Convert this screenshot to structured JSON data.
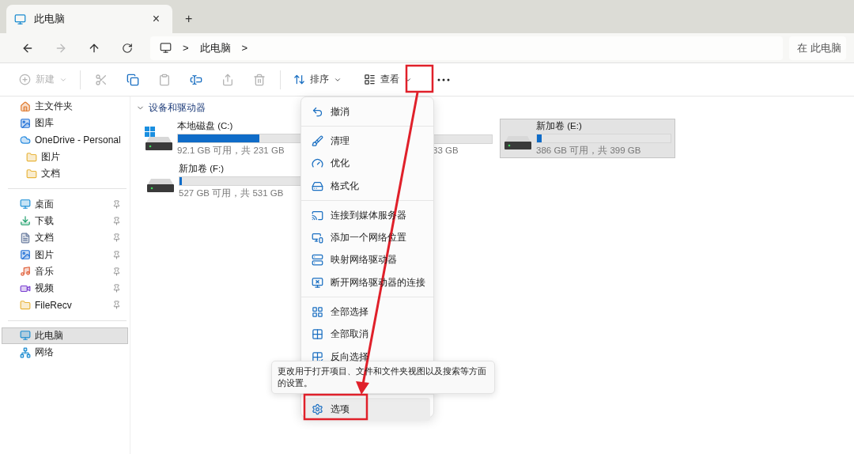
{
  "tabs": [
    {
      "title": "此电脑",
      "selected": true,
      "close": "×"
    }
  ],
  "new_tab": "+",
  "address": {
    "crumbs": [
      "此电脑"
    ],
    "separator": ">"
  },
  "search": {
    "placeholder": "在 此电脑"
  },
  "toolbar": {
    "new": {
      "label": "新建",
      "disabled": true
    },
    "actions": [
      {
        "kind": "cut",
        "disabled": true
      },
      {
        "kind": "copy",
        "disabled": false
      },
      {
        "kind": "paste",
        "disabled": true
      },
      {
        "kind": "rename",
        "disabled": false
      },
      {
        "kind": "share",
        "disabled": true
      },
      {
        "kind": "delete",
        "disabled": true
      }
    ],
    "sort": "排序",
    "view": "查看"
  },
  "sidebar": {
    "sections": [
      [
        {
          "label": "主文件夹",
          "pinned": false,
          "selected": false
        },
        {
          "label": "图库",
          "pinned": false,
          "selected": false
        },
        {
          "label": "OneDrive - Personal",
          "pinned": false,
          "selected": false,
          "children": [
            {
              "label": "图片",
              "pinned": false,
              "selected": false
            },
            {
              "label": "文档",
              "pinned": false,
              "selected": false
            }
          ]
        }
      ],
      [
        {
          "label": "桌面",
          "pinned": true,
          "selected": false
        },
        {
          "label": "下载",
          "pinned": true,
          "selected": false
        },
        {
          "label": "文档",
          "pinned": true,
          "selected": false
        },
        {
          "label": "图片",
          "pinned": true,
          "selected": false
        },
        {
          "label": "音乐",
          "pinned": true,
          "selected": false
        },
        {
          "label": "视频",
          "pinned": true,
          "selected": false
        },
        {
          "label": "FileRecv",
          "pinned": true,
          "selected": false
        }
      ],
      [
        {
          "label": "此电脑",
          "pinned": false,
          "selected": true
        },
        {
          "label": "网络",
          "pinned": false,
          "selected": false
        }
      ]
    ]
  },
  "group": {
    "title": "设备和驱动器",
    "expanded": true
  },
  "drives": [
    {
      "kind": "drive",
      "name": "本地磁盘 (C:)",
      "system": true,
      "level": 0.6,
      "space": "92.1 GB 可用，共 231 GB",
      "selected": false
    },
    {
      "kind": "covered",
      "space": "33 GB",
      "selected": false
    },
    {
      "kind": "drive",
      "name": "新加卷 (E:)",
      "system": false,
      "level": 0.033,
      "space": "386 GB 可用，共 399 GB",
      "selected": true
    },
    {
      "kind": "drive",
      "name": "新加卷 (F:)",
      "system": false,
      "level": 0.012,
      "space": "527 GB 可用，共 531 GB",
      "selected": false
    }
  ],
  "menu": {
    "groups": [
      [
        {
          "label": "撤消",
          "hover": false
        }
      ],
      [
        {
          "label": "清理",
          "hover": false
        },
        {
          "label": "优化",
          "hover": false
        },
        {
          "label": "格式化",
          "hover": false
        }
      ],
      [
        {
          "label": "连接到媒体服务器",
          "hover": false
        },
        {
          "label": "添加一个网络位置",
          "hover": false
        },
        {
          "label": "映射网络驱动器",
          "hover": false
        },
        {
          "label": "断开网络驱动器的连接",
          "hover": false
        }
      ],
      [
        {
          "label": "全部选择",
          "hover": false
        },
        {
          "label": "全部取消",
          "hover": false
        },
        {
          "label": "反向选择",
          "hover": false
        }
      ],
      [
        {
          "label": "选项",
          "hover": true
        }
      ]
    ]
  },
  "tooltip": "更改用于打开项目、文件和文件夹视图以及搜索等方面的设置。"
}
